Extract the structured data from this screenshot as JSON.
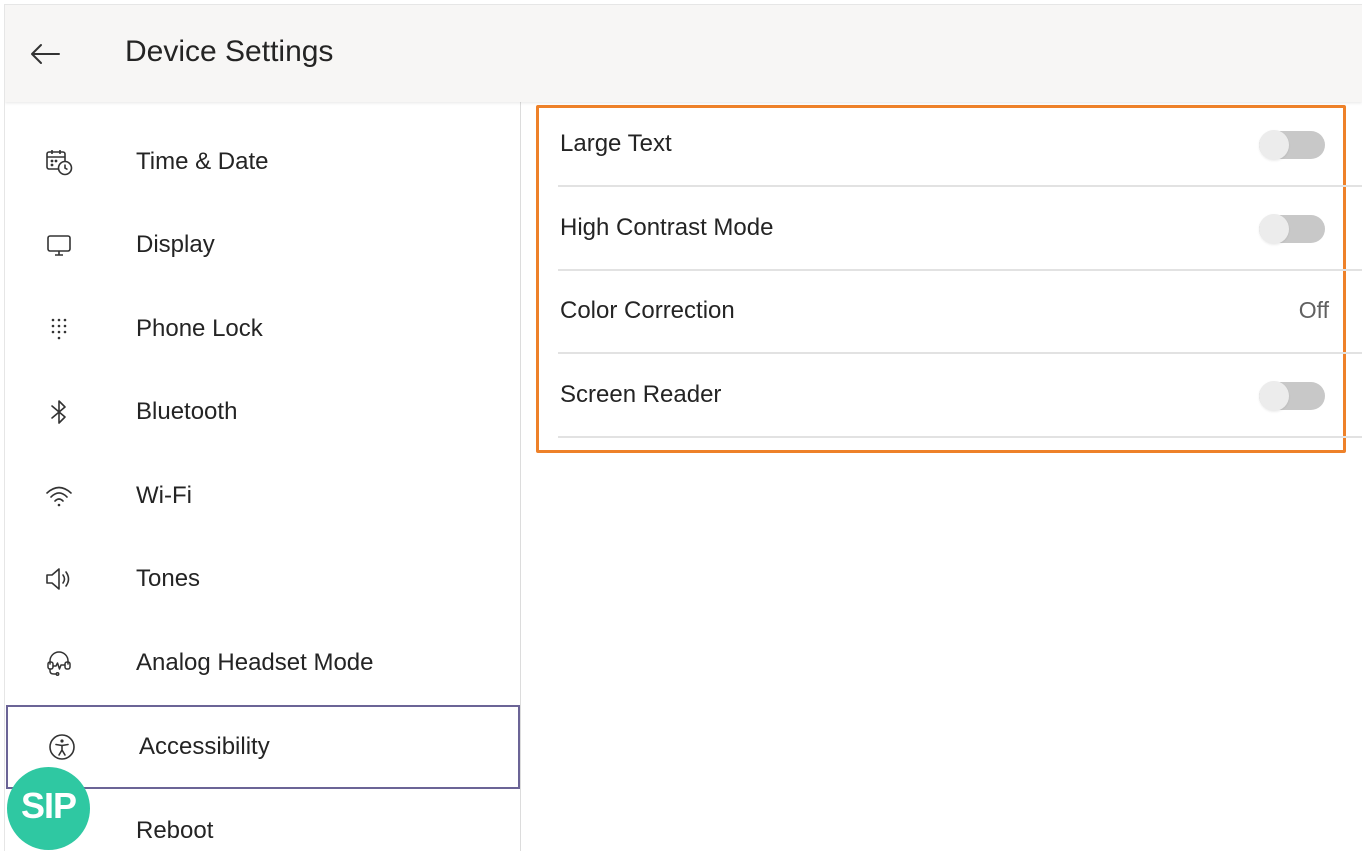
{
  "header": {
    "title": "Device Settings"
  },
  "sidebar": {
    "items": [
      {
        "label": "Time & Date",
        "icon": "calendar-clock-icon"
      },
      {
        "label": "Display",
        "icon": "monitor-icon"
      },
      {
        "label": "Phone Lock",
        "icon": "keypad-icon"
      },
      {
        "label": "Bluetooth",
        "icon": "bluetooth-icon"
      },
      {
        "label": "Wi-Fi",
        "icon": "wifi-icon"
      },
      {
        "label": "Tones",
        "icon": "speaker-icon"
      },
      {
        "label": "Analog Headset Mode",
        "icon": "headset-icon"
      },
      {
        "label": "Accessibility",
        "icon": "accessibility-icon",
        "selected": true
      },
      {
        "label": "Reboot",
        "icon": "power-icon"
      }
    ]
  },
  "settings": {
    "rows": [
      {
        "label": "Large Text",
        "control": "toggle",
        "on": false
      },
      {
        "label": "High Contrast Mode",
        "control": "toggle",
        "on": false
      },
      {
        "label": "Color Correction",
        "control": "value",
        "value": "Off"
      },
      {
        "label": "Screen Reader",
        "control": "toggle",
        "on": false
      }
    ]
  },
  "badge": {
    "text": "SIP"
  },
  "colors": {
    "highlight": "#ee8129",
    "selected_border": "#6b6496",
    "badge": "#2fc8a2",
    "header_bg": "#f7f6f5"
  }
}
